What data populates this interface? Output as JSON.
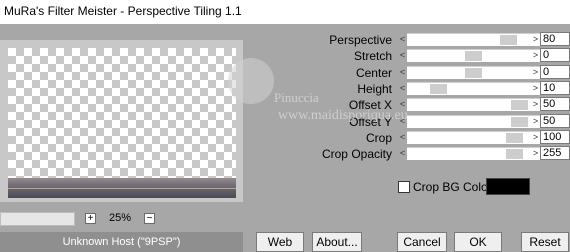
{
  "window": {
    "title": "MuRa's Filter Meister - Perspective Tiling 1.1"
  },
  "sliders": [
    {
      "label": "Perspective",
      "value": "80",
      "level": 0.8
    },
    {
      "label": "Stretch",
      "value": "0",
      "level": 0.5
    },
    {
      "label": "Center",
      "value": "0",
      "level": 0.5
    },
    {
      "label": "Height",
      "value": "10",
      "level": 0.2
    },
    {
      "label": "Offset X",
      "value": "50",
      "level": 0.9
    },
    {
      "label": "Offset Y",
      "value": "50",
      "level": 0.9
    },
    {
      "label": "Crop",
      "value": "100",
      "level": 0.85
    },
    {
      "label": "Crop Opacity",
      "value": "255",
      "level": 0.85
    }
  ],
  "crop_bg": {
    "label": "Crop BG Color",
    "checked": false,
    "color": "#000000"
  },
  "zoom": {
    "plus": "+",
    "minus": "−",
    "value": "25%"
  },
  "status": {
    "text": "Unknown Host (\"9PSP\")"
  },
  "buttons": {
    "web": "Web",
    "about": "About...",
    "cancel": "Cancel",
    "ok": "OK",
    "reset": "Reset"
  },
  "watermark": {
    "line1": "Pinuccia",
    "line2": "www.maidisporiqua.eu"
  },
  "colors": {
    "background": "#a7a7a7",
    "panel": "#f0f0f0",
    "swatch": "#000000"
  }
}
